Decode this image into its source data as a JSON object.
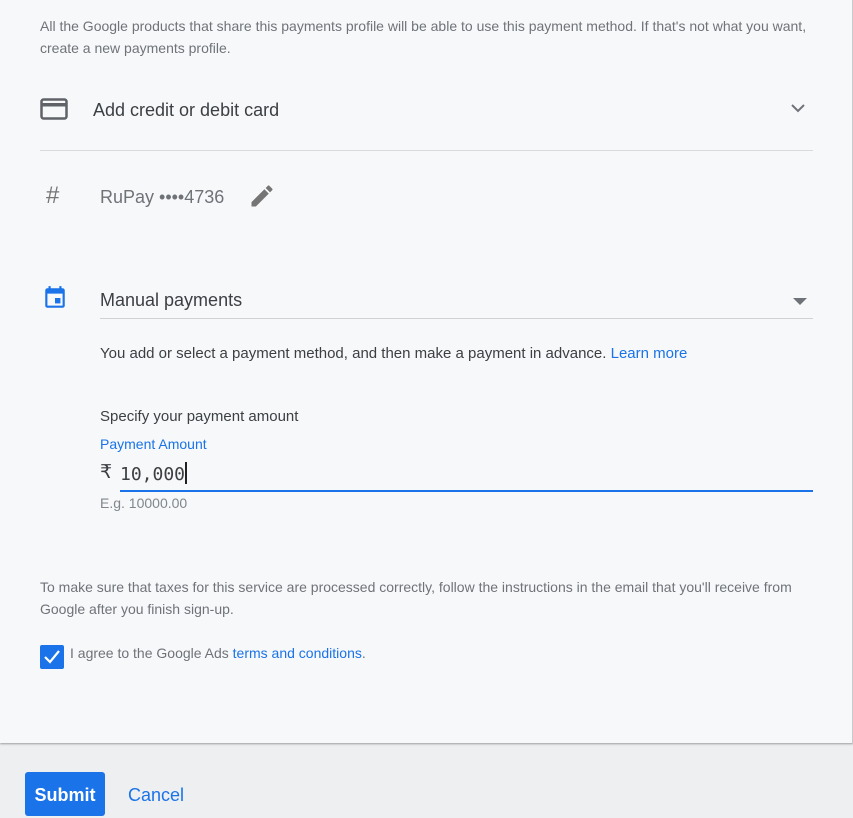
{
  "info": {
    "text": "All the Google products that share this payments profile will be able to use this payment method. If that's not what you want, create a new payments profile."
  },
  "card_option": {
    "label": "Add credit or debit card",
    "icon": "credit-card-icon",
    "expand_icon": "chevron-down-icon"
  },
  "saved_card": {
    "icon": "hash-icon",
    "label": "RuPay ••••4736",
    "edit_icon": "pencil-icon"
  },
  "payment_setting": {
    "icon": "calendar-icon",
    "selected": "Manual payments",
    "description": "You add or select a payment method, and then make a payment in advance.",
    "learn_more": "Learn more"
  },
  "amount": {
    "heading": "Specify your payment amount",
    "label": "Payment Amount",
    "currency_symbol": "₹",
    "value": "10,000",
    "hint": "E.g. 10000.00"
  },
  "tax_notice": "To make sure that taxes for this service are processed correctly, follow the instructions in the email that you'll receive from Google after you finish sign-up.",
  "agreement": {
    "checked": true,
    "prefix": "I agree to the Google Ads",
    "link": "terms and conditions",
    "suffix": "."
  },
  "actions": {
    "submit": "Submit",
    "cancel": "Cancel"
  },
  "colors": {
    "accent": "#1a73e8",
    "background": "#f7f8fa",
    "muted_text": "#6f7378"
  }
}
